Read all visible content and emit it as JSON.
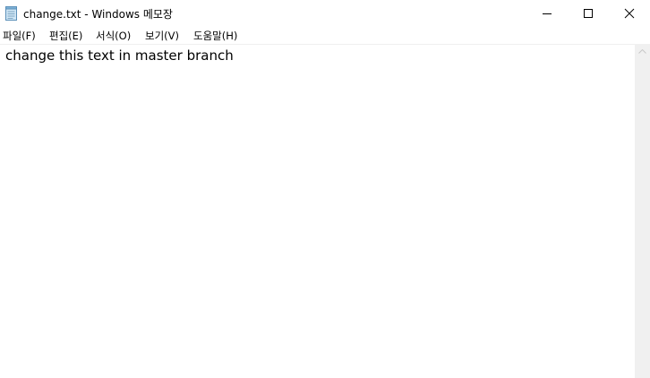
{
  "window": {
    "title": "change.txt - Windows 메모장",
    "icons": {
      "app": "notepad-icon",
      "minimize": "minimize-icon",
      "maximize": "maximize-icon",
      "close": "close-icon",
      "scroll_up": "chevron-up-icon"
    }
  },
  "menubar": {
    "items": [
      {
        "label": "파일(F)"
      },
      {
        "label": "편집(E)"
      },
      {
        "label": "서식(O)"
      },
      {
        "label": "보기(V)"
      },
      {
        "label": "도움말(H)"
      }
    ]
  },
  "editor": {
    "content": "change this text in master branch"
  }
}
